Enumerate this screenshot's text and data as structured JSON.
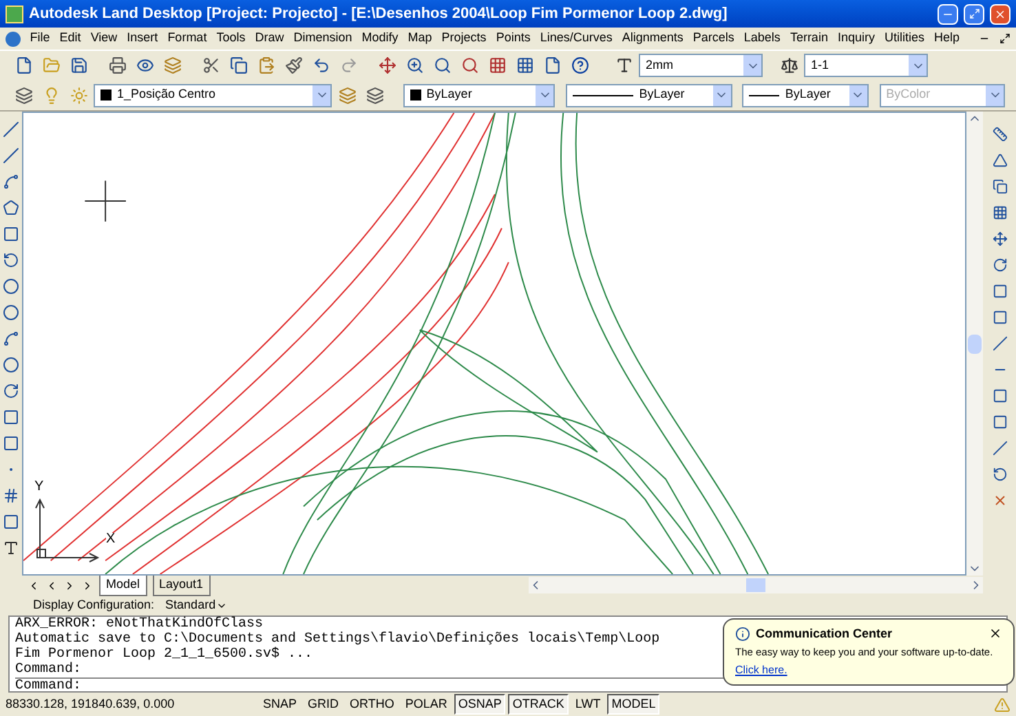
{
  "window": {
    "title": "Autodesk Land Desktop [Project: Projecto] - [E:\\Desenhos 2004\\Loop Fim Pormenor Loop 2.dwg]"
  },
  "menu": [
    "File",
    "Edit",
    "View",
    "Insert",
    "Format",
    "Tools",
    "Draw",
    "Dimension",
    "Modify",
    "Map",
    "Projects",
    "Points",
    "Lines/Curves",
    "Alignments",
    "Parcels",
    "Labels",
    "Terrain",
    "Inquiry",
    "Utilities",
    "Help"
  ],
  "toolbar": {
    "text_height": "2mm",
    "scale": "1-1"
  },
  "properties": {
    "layer": "1_Posição Centro",
    "color_control": "ByLayer",
    "linetype": "ByLayer",
    "lineweight": "ByLayer",
    "plotstyle": "ByColor"
  },
  "ucs": {
    "y_label": "Y",
    "x_label": "X"
  },
  "layout_tabs": [
    {
      "label": "Model",
      "selected": true
    },
    {
      "label": "Layout1",
      "selected": false
    }
  ],
  "display_configuration": {
    "label": "Display Configuration:",
    "value": "Standard"
  },
  "command_history": [
    "ARX_ERROR: eNotThatKindOfClass",
    "Automatic save to C:\\Documents and Settings\\flavio\\Definições locais\\Temp\\Loop",
    "Fim Pormenor Loop 2_1_1_6500.sv$ ...",
    "Command:"
  ],
  "command_prompt": "Command:",
  "balloon": {
    "title": "Communication Center",
    "text": "The easy way to keep you and your software up-to-date.",
    "link": "Click here."
  },
  "status_bar": {
    "coordinates": "88330.128, 191840.639, 0.000",
    "toggles": [
      {
        "label": "SNAP",
        "on": false
      },
      {
        "label": "GRID",
        "on": false
      },
      {
        "label": "ORTHO",
        "on": false
      },
      {
        "label": "POLAR",
        "on": false
      },
      {
        "label": "OSNAP",
        "on": true
      },
      {
        "label": "OTRACK",
        "on": true
      },
      {
        "label": "LWT",
        "on": false
      },
      {
        "label": "MODEL",
        "on": true
      }
    ]
  }
}
